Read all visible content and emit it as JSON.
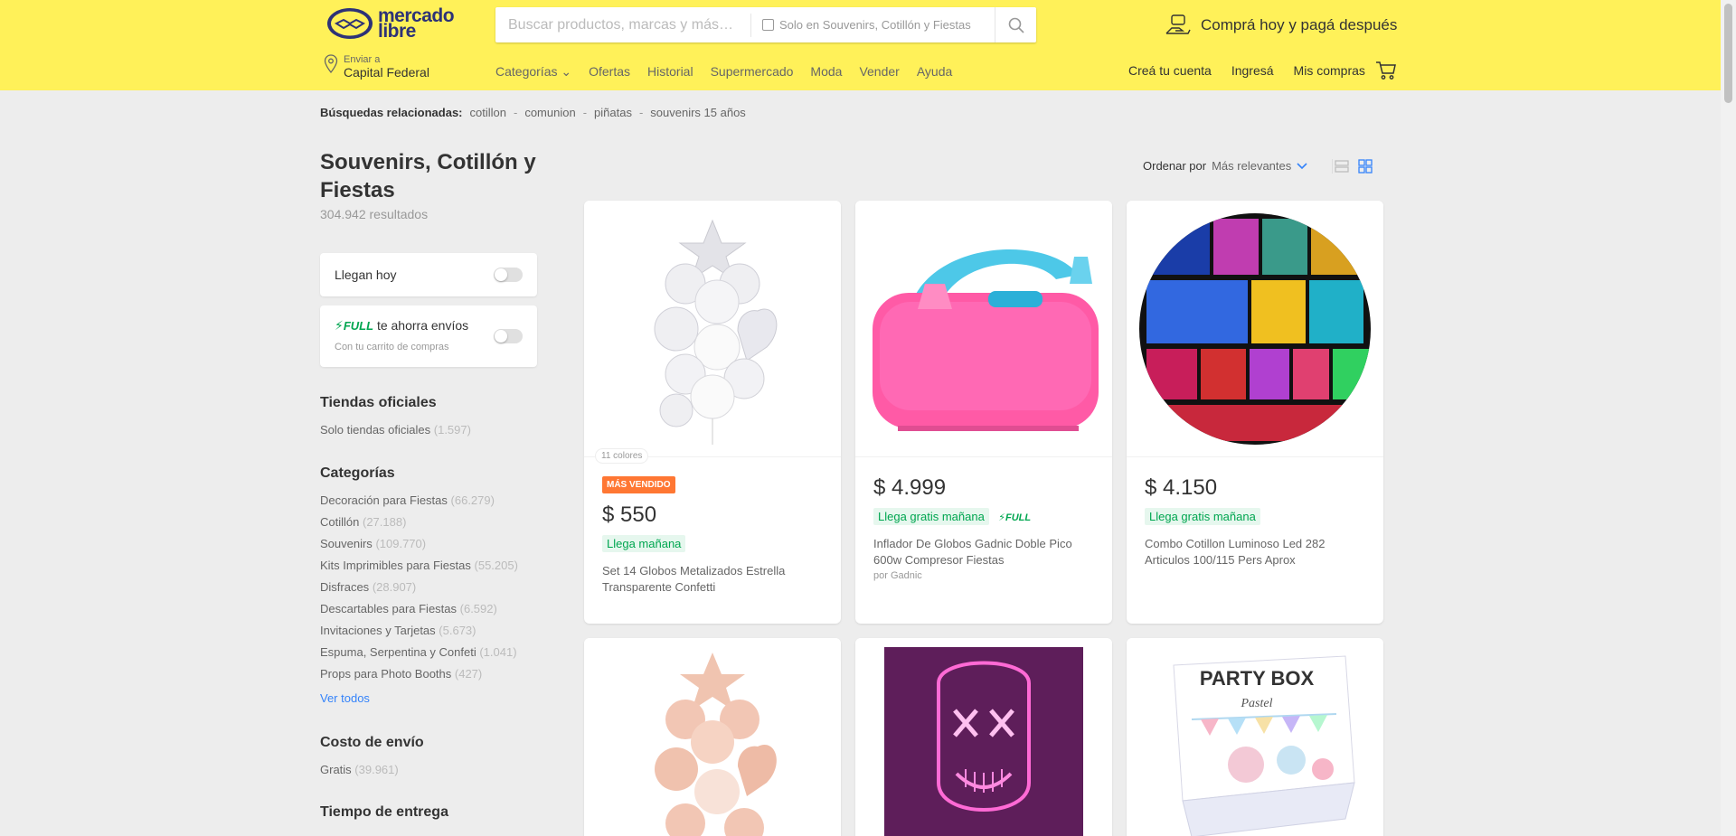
{
  "header": {
    "logo_line1": "mercado",
    "logo_line2": "libre",
    "search_placeholder": "Buscar productos, marcas y más…",
    "search_scope": "Solo en Souvenirs, Cotillón y Fiestas",
    "promo": "Comprá hoy y pagá después",
    "location_label": "Enviar a",
    "location_value": "Capital Federal",
    "nav": [
      "Categorías",
      "Ofertas",
      "Historial",
      "Supermercado",
      "Moda",
      "Vender",
      "Ayuda"
    ],
    "user_nav": [
      "Creá tu cuenta",
      "Ingresá",
      "Mis compras"
    ]
  },
  "related": {
    "label": "Búsquedas relacionadas:",
    "items": [
      "cotillon",
      "comunion",
      "piñatas",
      "souvenirs 15 años"
    ]
  },
  "page": {
    "title": "Souvenirs, Cotillón y Fiestas",
    "results": "304.942 resultados"
  },
  "filters": {
    "today": "Llegan hoy",
    "full_badge": "FULL",
    "full_text": "te ahorra envíos",
    "full_sub": "Con tu carrito de compras"
  },
  "sidebar": {
    "official_title": "Tiendas oficiales",
    "official_item": "Solo tiendas oficiales",
    "official_count": "(1.597)",
    "categories_title": "Categorías",
    "categories": [
      {
        "name": "Decoración para Fiestas",
        "count": "(66.279)"
      },
      {
        "name": "Cotillón",
        "count": "(27.188)"
      },
      {
        "name": "Souvenirs",
        "count": "(109.770)"
      },
      {
        "name": "Kits Imprimibles para Fiestas",
        "count": "(55.205)"
      },
      {
        "name": "Disfraces",
        "count": "(28.907)"
      },
      {
        "name": "Descartables para Fiestas",
        "count": "(6.592)"
      },
      {
        "name": "Invitaciones y Tarjetas",
        "count": "(5.673)"
      },
      {
        "name": "Espuma, Serpentina y Confeti",
        "count": "(1.041)"
      },
      {
        "name": "Props para Photo Booths",
        "count": "(427)"
      }
    ],
    "see_all": "Ver todos",
    "shipping_title": "Costo de envío",
    "shipping_item": "Gratis",
    "shipping_count": "(39.961)",
    "delivery_title": "Tiempo de entrega"
  },
  "sort": {
    "label": "Ordenar por",
    "value": "Más relevantes"
  },
  "products": [
    {
      "colors": "11 colores",
      "badge": "MÁS VENDIDO",
      "price": "$ 550",
      "shipping": "Llega mañana",
      "name": "Set 14 Globos Metalizados Estrella Transparente Confetti"
    },
    {
      "price": "$ 4.999",
      "shipping": "Llega gratis mañana",
      "full": "FULL",
      "name": "Inflador De Globos Gadnic Doble Pico 600w Compresor Fiestas",
      "seller": "por Gadnic"
    },
    {
      "price": "$ 4.150",
      "shipping": "Llega gratis mañana",
      "name": "Combo Cotillon Luminoso Led 282 Articulos 100/115 Pers Aprox"
    },
    {
      "image_text": "PARTY BOX",
      "image_subtext": "Pastel"
    }
  ],
  "colors": {
    "header_bg": "#fff159",
    "accent": "#3483fa",
    "green": "#00a650",
    "orange": "#ff7733"
  }
}
